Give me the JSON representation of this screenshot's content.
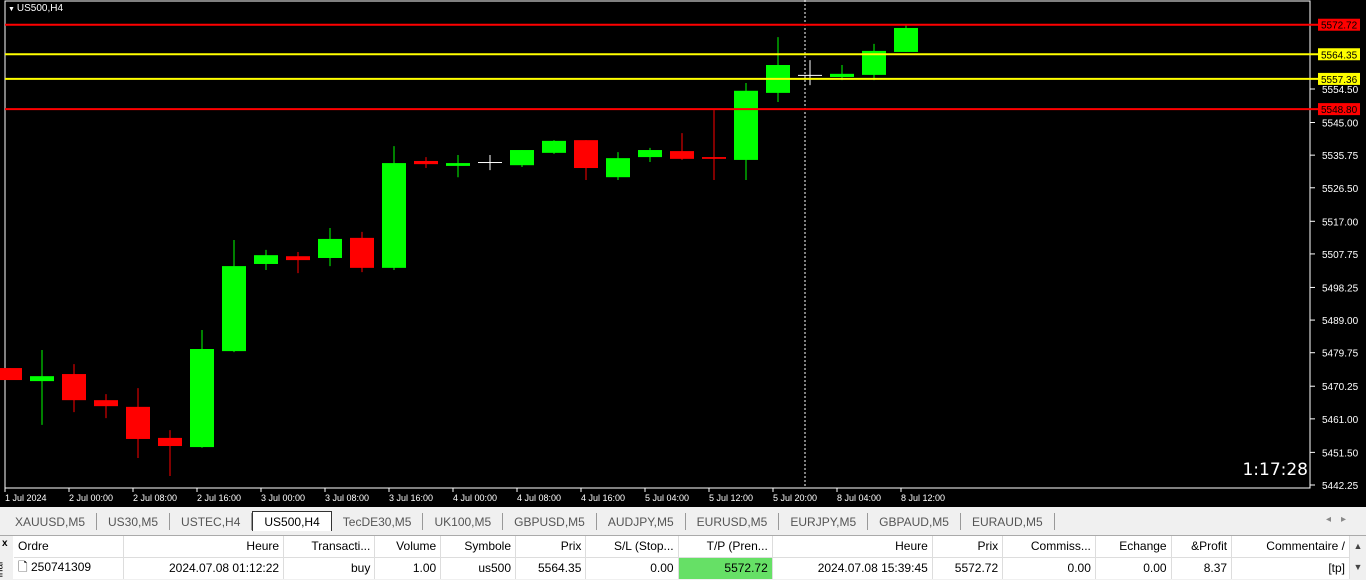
{
  "chart": {
    "symbol": "US500,H4",
    "countdown": "1:17:28",
    "colors": {
      "bull": "#00ff00",
      "bear": "#ff0000",
      "doji": "#ffffff",
      "tp_line": "#ff0000",
      "entry_line": "#ffff00"
    },
    "price_range": [
      5442.25,
      5554.5
    ],
    "price_ticks": [
      "5554.50",
      "5545.00",
      "5535.75",
      "5526.50",
      "5517.00",
      "5507.75",
      "5498.25",
      "5489.00",
      "5479.75",
      "5470.25",
      "5461.00",
      "5451.50",
      "5442.25"
    ],
    "levels": [
      {
        "price": "5572.72",
        "type": "red"
      },
      {
        "price": "5564.35",
        "type": "yellow"
      },
      {
        "price": "5557.36",
        "type": "yellow"
      },
      {
        "price": "5548.80",
        "type": "red"
      }
    ],
    "time_labels": [
      "1 Jul 2024",
      "2 Jul 00:00",
      "2 Jul 08:00",
      "2 Jul 16:00",
      "3 Jul 00:00",
      "3 Jul 08:00",
      "3 Jul 16:00",
      "4 Jul 00:00",
      "4 Jul 08:00",
      "4 Jul 16:00",
      "5 Jul 04:00",
      "5 Jul 12:00",
      "5 Jul 20:00",
      "8 Jul 04:00",
      "8 Jul 12:00"
    ],
    "candles": [
      [
        5475.4,
        5475.4,
        5472.0,
        5472.0
      ],
      [
        5471.7,
        5480.5,
        5459.3,
        5473.1
      ],
      [
        5473.7,
        5476.5,
        5462.9,
        5466.3
      ],
      [
        5466.3,
        5468.0,
        5461.2,
        5464.6
      ],
      [
        5464.4,
        5469.7,
        5449.9,
        5455.3
      ],
      [
        5455.6,
        5457.8,
        5444.8,
        5453.3
      ],
      [
        5453.0,
        5486.2,
        5452.8,
        5480.8
      ],
      [
        5480.2,
        5511.7,
        5479.9,
        5504.3
      ],
      [
        5504.9,
        5508.9,
        5503.2,
        5507.4
      ],
      [
        5507.1,
        5508.3,
        5502.3,
        5506.0
      ],
      [
        5506.6,
        5515.1,
        5504.3,
        5512.0
      ],
      [
        5512.3,
        5514.0,
        5502.6,
        5503.8
      ],
      [
        5503.8,
        5538.3,
        5503.2,
        5533.5
      ],
      [
        5534.1,
        5535.2,
        5532.1,
        5533.2
      ],
      [
        5532.7,
        5535.8,
        5529.5,
        5533.5
      ],
      [
        5533.8,
        5535.8,
        5531.5,
        5533.8
      ],
      [
        5532.9,
        5537.2,
        5532.4,
        5537.2
      ],
      [
        5536.4,
        5540.0,
        5536.1,
        5539.8
      ],
      [
        5540.0,
        5540.0,
        5528.7,
        5532.1
      ],
      [
        5529.5,
        5536.6,
        5528.7,
        5534.9
      ],
      [
        5535.2,
        5537.8,
        5533.8,
        5537.2
      ],
      [
        5536.9,
        5542.0,
        5534.4,
        5534.7
      ],
      [
        5535.2,
        5548.5,
        5528.7,
        5534.7
      ],
      [
        5534.4,
        5556.2,
        5528.7,
        5554.0
      ],
      [
        5553.4,
        5569.2,
        5550.8,
        5561.3
      ],
      [
        5558.5,
        5562.7,
        5555.6,
        5558.5
      ],
      [
        5557.9,
        5561.3,
        5557.0,
        5558.8
      ],
      [
        5558.5,
        5567.3,
        5557.0,
        5565.3
      ],
      [
        5565.0,
        5572.9,
        5565.0,
        5571.8
      ]
    ]
  },
  "tabs": [
    {
      "label": "XAUUSD,M5"
    },
    {
      "label": "US30,M5"
    },
    {
      "label": "USTEC,H4"
    },
    {
      "label": "US500,H4",
      "active": true
    },
    {
      "label": "TecDE30,M5"
    },
    {
      "label": "UK100,M5"
    },
    {
      "label": "GBPUSD,M5"
    },
    {
      "label": "AUDJPY,M5"
    },
    {
      "label": "EURUSD,M5"
    },
    {
      "label": "EURJPY,M5"
    },
    {
      "label": "GBPAUD,M5"
    },
    {
      "label": "EURAUD,M5"
    }
  ],
  "terminal": {
    "side_label": "inal",
    "close": "x",
    "headers": [
      "Ordre",
      "Heure",
      "Transacti...",
      "Volume",
      "Symbole",
      "Prix",
      "S/L (Stop...",
      "T/P (Pren...",
      "Heure",
      "Prix",
      "Commiss...",
      "Echange",
      "&Profit",
      "Commentaire  /"
    ],
    "row": [
      "250741309",
      "2024.07.08 01:12:22",
      "buy",
      "1.00",
      "us500",
      "5564.35",
      "0.00",
      "5572.72",
      "2024.07.08 15:39:45",
      "5572.72",
      "0.00",
      "0.00",
      "8.37",
      "[tp]"
    ]
  }
}
